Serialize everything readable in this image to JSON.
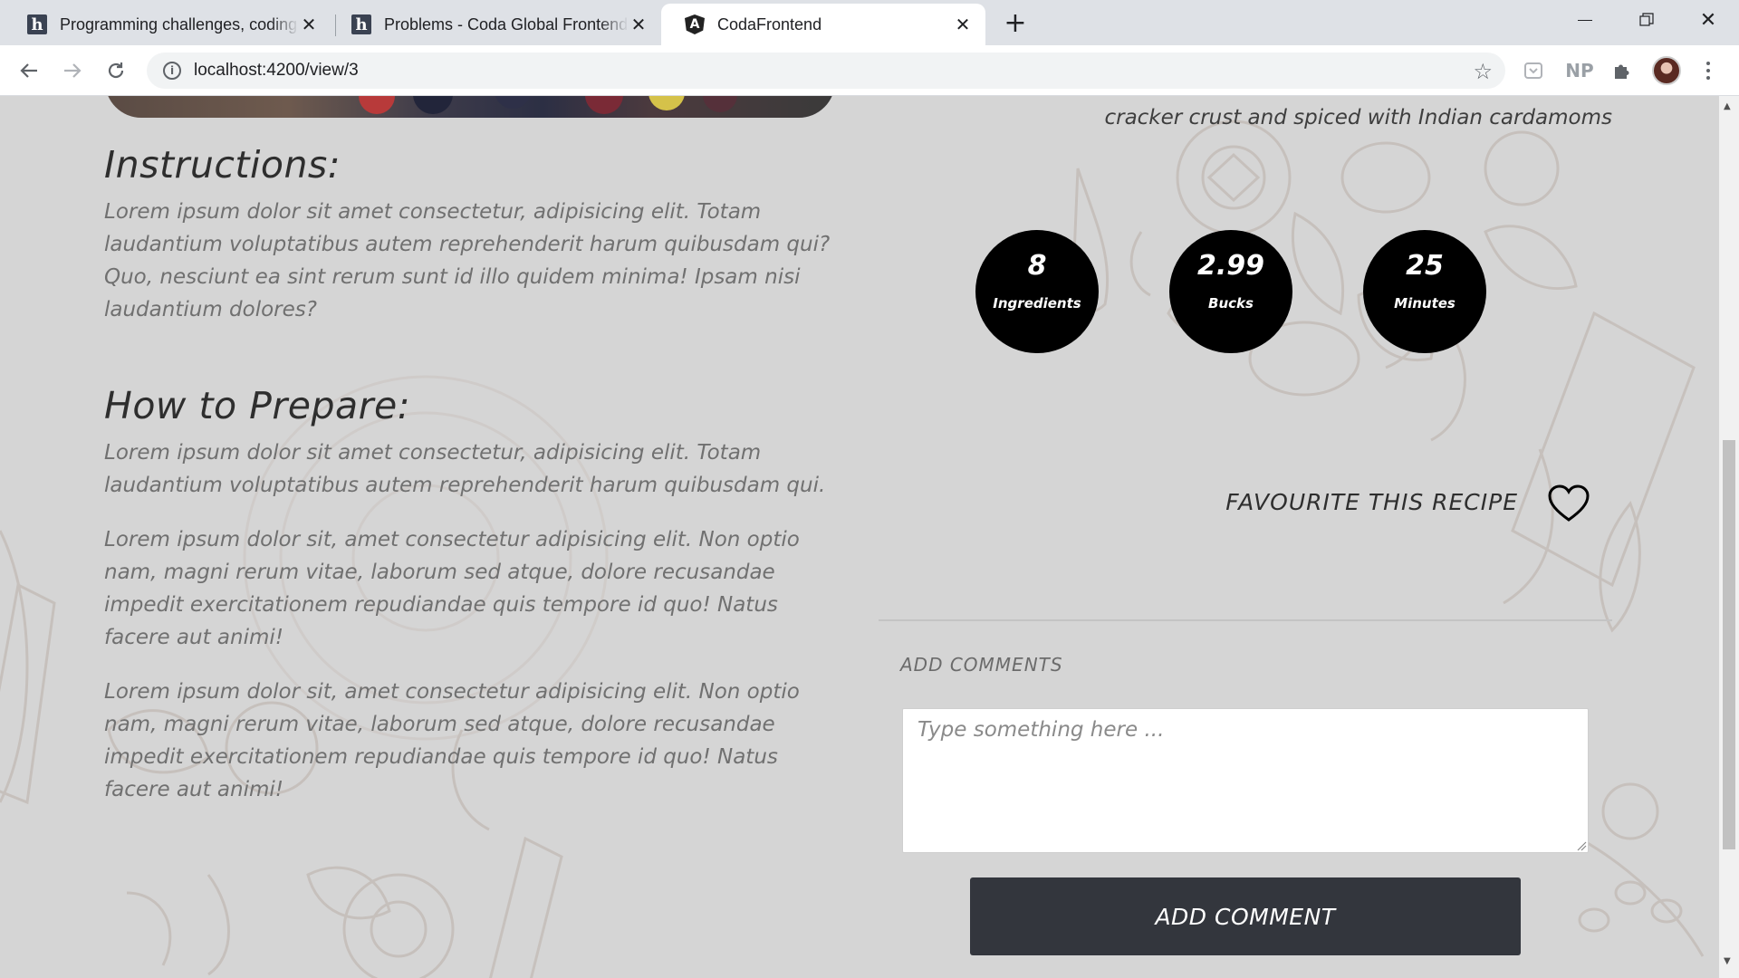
{
  "browser": {
    "tabs": [
      {
        "title": "Programming challenges, coding",
        "icon": "hackerrank-icon",
        "active": false
      },
      {
        "title": "Problems - Coda Global Frontend",
        "icon": "hackerrank-icon",
        "active": false
      },
      {
        "title": "CodaFrontend",
        "icon": "angular-icon",
        "active": true
      }
    ],
    "url": "localhost:4200/view/3",
    "extensions": [
      "pocket-icon",
      "np-extension-icon",
      "puzzle-icon"
    ],
    "extension_np_label": "NP"
  },
  "recipe": {
    "description": "A delectable, semi-sweet New York Style Cheese Cake, with Graham cracker crust and spiced with Indian cardamoms",
    "stats": [
      {
        "value": "8",
        "label": "Ingredients"
      },
      {
        "value": "2.99",
        "label": "Bucks"
      },
      {
        "value": "25",
        "label": "Minutes"
      }
    ],
    "favourite_label": "FAVOURITE THIS RECIPE",
    "instructions": {
      "heading": "Instructions:",
      "text": "Lorem ipsum dolor sit amet consectetur, adipisicing elit. Totam laudantium voluptatibus autem reprehenderit harum quibusdam qui? Quo, nesciunt ea sint rerum sunt id illo quidem minima! Ipsam nisi laudantium dolores?"
    },
    "prepare": {
      "heading": "How to Prepare:",
      "paragraphs": [
        "Lorem ipsum dolor sit amet consectetur, adipisicing elit. Totam laudantium voluptatibus autem reprehenderit harum quibusdam qui.",
        "Lorem ipsum dolor sit, amet consectetur adipisicing elit. Non optio nam, magni rerum vitae, laborum sed atque, dolore recusandae impedit exercitationem repudiandae quis tempore id quo! Natus facere aut animi!",
        "Lorem ipsum dolor sit, amet consectetur adipisicing elit. Non optio nam, magni rerum vitae, laborum sed atque, dolore recusandae impedit exercitationem repudiandae quis tempore id quo! Natus facere aut animi!"
      ]
    }
  },
  "comments": {
    "label": "ADD COMMENTS",
    "placeholder": "Type something here ...",
    "button_label": "ADD COMMENT"
  },
  "colors": {
    "page_bg": "#d5d5d5",
    "stat_circle": "#000000",
    "button_bg": "#33363d"
  }
}
